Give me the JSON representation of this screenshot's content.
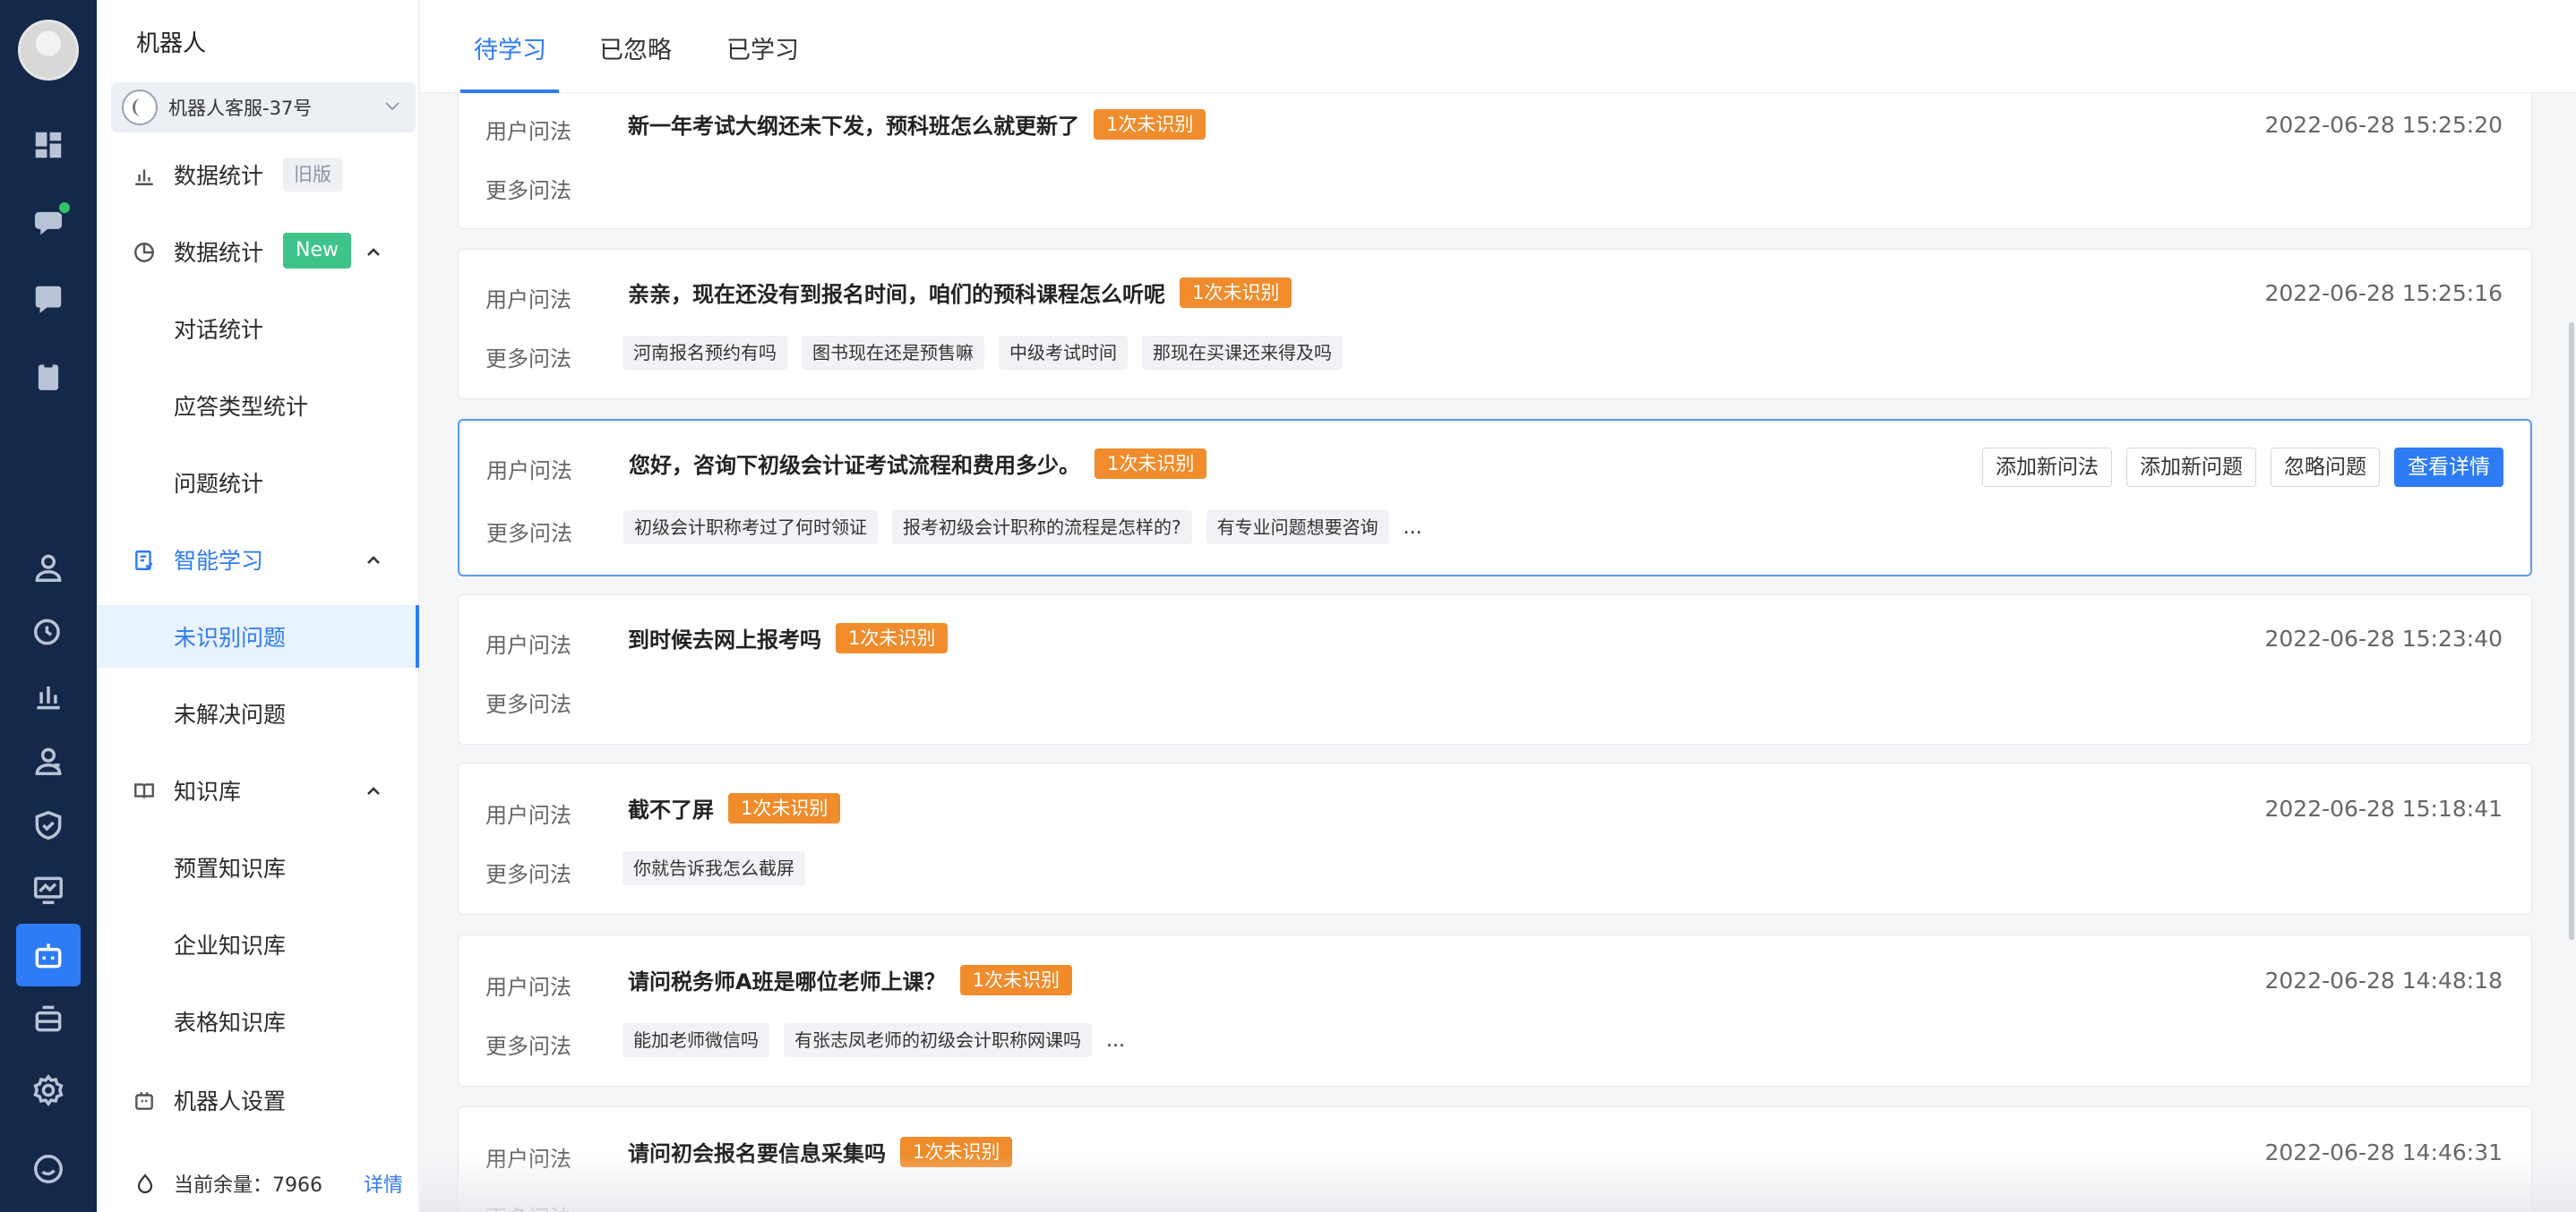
{
  "rail": {
    "icons": [
      "dashboard-icon",
      "chat-icon",
      "phone-chat-icon",
      "clipboard-icon",
      "user-icon",
      "clock-user-icon",
      "bar-chart-icon",
      "team-icon",
      "shield-icon",
      "monitor-icon",
      "robot-icon",
      "robot-group-icon",
      "gear-icon",
      "message-icon"
    ],
    "active": "robot-icon"
  },
  "menu": {
    "title": "机器人",
    "robot_name": "机器人客服-37号",
    "items": [
      {
        "label": "数据统计",
        "tag": "旧版"
      },
      {
        "label": "数据统计",
        "tag": "New"
      },
      {
        "label": "对话统计"
      },
      {
        "label": "应答类型统计"
      },
      {
        "label": "问题统计"
      },
      {
        "label": "智能学习"
      },
      {
        "label": "未识别问题"
      },
      {
        "label": "未解决问题"
      },
      {
        "label": "知识库"
      },
      {
        "label": "预置知识库"
      },
      {
        "label": "企业知识库"
      },
      {
        "label": "表格知识库"
      },
      {
        "label": "机器人设置"
      }
    ],
    "balance_label": "当前余量：7966",
    "balance_link": "详情"
  },
  "tabs": [
    "待学习",
    "已忽略",
    "已学习"
  ],
  "labels": {
    "user_question": "用户问法",
    "more_questions": "更多问法"
  },
  "badge": "1次未识别",
  "actions": [
    "添加新问法",
    "添加新问题",
    "忽略问题",
    "查看详情"
  ],
  "cards": [
    {
      "question": "新一年考试大纲还未下发，预科班怎么就更新了",
      "time": "2022-06-28 15:25:20",
      "alts": [],
      "more": ""
    },
    {
      "question": "亲亲，现在还没有到报名时间，咱们的预科课程怎么听呢",
      "time": "2022-06-28 15:25:16",
      "alts": [
        "河南报名预约有吗",
        "图书现在还是预售嘛",
        "中级考试时间",
        "那现在买课还来得及吗"
      ],
      "more": ""
    },
    {
      "question": "您好，咨询下初级会计证考试流程和费用多少。",
      "time": "",
      "alts": [
        "初级会计职称考过了何时领证",
        "报考初级会计职称的流程是怎样的?",
        "有专业问题想要咨询"
      ],
      "more": "..."
    },
    {
      "question": "到时候去网上报考吗",
      "time": "2022-06-28 15:23:40",
      "alts": [],
      "more": ""
    },
    {
      "question": "截不了屏",
      "time": "2022-06-28 15:18:41",
      "alts": [
        "你就告诉我怎么截屏"
      ],
      "more": ""
    },
    {
      "question": "请问税务师A班是哪位老师上课？",
      "time": "2022-06-28 14:48:18",
      "alts": [
        "能加老师微信吗",
        "有张志凤老师的初级会计职称网课吗"
      ],
      "more": "..."
    },
    {
      "question": "请问初会报名要信息采集吗",
      "time": "2022-06-28 14:46:31",
      "alts": [],
      "more": ""
    }
  ],
  "colors": {
    "accent": "#2e7bf6",
    "badge": "#f08c2c",
    "new_tag": "#3ec48a",
    "rail": "#14284a"
  }
}
